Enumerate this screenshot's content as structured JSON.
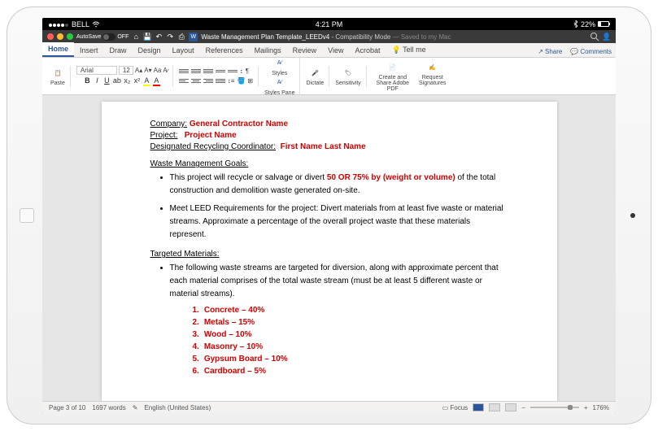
{
  "statusbar": {
    "carrier": "BELL",
    "time": "4:21 PM",
    "battery": "22%"
  },
  "titlebar": {
    "autosave_label": "AutoSave",
    "autosave_state": "OFF",
    "icon_word": "W",
    "doc_name": "Waste Management Plan Template_LEEDv4",
    "compat": " - Compatibility Mode",
    "saved": " — Saved to my Mac"
  },
  "tabs": {
    "items": [
      "Home",
      "Insert",
      "Draw",
      "Design",
      "Layout",
      "References",
      "Mailings",
      "Review",
      "View",
      "Acrobat"
    ],
    "tell_me": "Tell me",
    "share": "Share",
    "comments": "Comments"
  },
  "ribbon": {
    "paste": "Paste",
    "font_name": "Arial",
    "font_size": "12",
    "bold": "B",
    "italic": "I",
    "underline": "U",
    "styles": "Styles",
    "styles_pane": "Styles Pane",
    "dictate": "Dictate",
    "sensitivity": "Sensitivity",
    "create_pdf": "Create and Share Adobe PDF",
    "req_sig": "Request Signatures"
  },
  "doc": {
    "company_label": "Company:",
    "company_val": "General Contractor Name",
    "project_label": "Project:",
    "project_val": "Project Name",
    "coord_label": "Designated Recycling Coordinator:",
    "coord_val": "First Name Last Name",
    "goals_title": "Waste Management Goals:",
    "goal1_a": "This project will recycle or salvage or divert ",
    "goal1_b": "50 OR 75% by (weight or volume)",
    "goal1_c": " of the total construction and demolition waste generated on-site.",
    "goal2": "Meet LEED Requirements for the project: Divert materials from at least five waste or material streams. Approximate a percentage of the overall project waste that these materials represent.",
    "targeted_title": "Targeted Materials:",
    "targeted_intro": "The following waste streams are targeted for diversion, along with approximate percent that each material comprises of the total waste stream (must be at least 5 different waste or material streams).",
    "materials": [
      {
        "n": "1.",
        "t": "Concrete – 40%"
      },
      {
        "n": "2.",
        "t": "Metals – 15%"
      },
      {
        "n": "3.",
        "t": "Wood – 10%"
      },
      {
        "n": "4.",
        "t": "Masonry – 10%"
      },
      {
        "n": "5.",
        "t": "Gypsum Board – 10%"
      },
      {
        "n": "6.",
        "t": "Cardboard – 5%"
      }
    ]
  },
  "statusbar2": {
    "page": "Page 3 of 10",
    "words": "1697 words",
    "lang": "English (United States)",
    "focus": "Focus",
    "zoom": "176%"
  }
}
